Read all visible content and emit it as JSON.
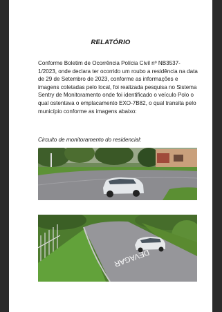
{
  "document": {
    "title": "RELATÓRIO",
    "paragraph": "Conforme Boletim de Ocorrência Polícia Civil nº NB3537-1/2023, onde declara ter ocorrido um roubo a residência na data de 29 de Setembro de 2023, conforme as informações e imagens coletadas pelo local, foi realizada pesquisa no Sistema Sentry de Monitoramento onde foi identificado o veículo Polo o qual ostentava o emplacamento EXO-7B82, o qual transita pelo município conforme as imagens abaixo:",
    "caption": "Circuito de monitoramento do residencial:",
    "road_marking": "DEVAGAR"
  },
  "colors": {
    "page": "#ffffff",
    "background": "#1f1f1f",
    "asphalt": "#8a8a8e",
    "grass": "#4f8a2c",
    "car": "#e6e8ea"
  }
}
